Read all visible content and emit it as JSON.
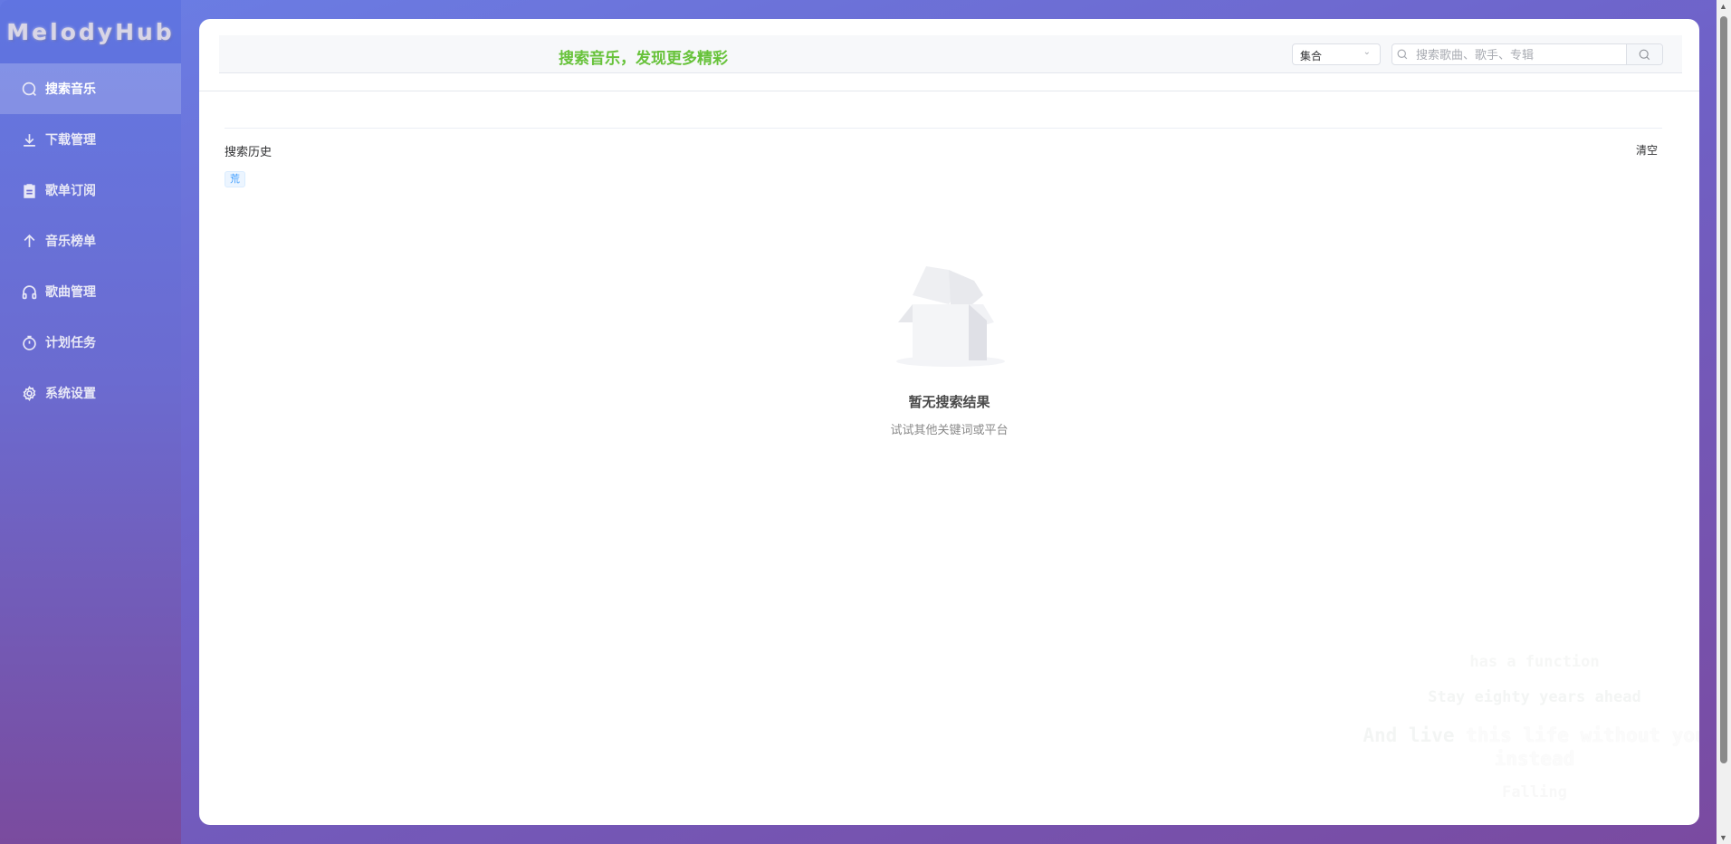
{
  "app": {
    "logo": "MelodyHub"
  },
  "sidebar": {
    "items": [
      {
        "label": "搜索音乐",
        "icon": "search-icon",
        "active": true
      },
      {
        "label": "下载管理",
        "icon": "download-icon"
      },
      {
        "label": "歌单订阅",
        "icon": "clipboard-icon"
      },
      {
        "label": "音乐榜单",
        "icon": "arrow-up-icon"
      },
      {
        "label": "歌曲管理",
        "icon": "headphones-icon"
      },
      {
        "label": "计划任务",
        "icon": "timer-icon"
      },
      {
        "label": "系统设置",
        "icon": "gear-icon"
      }
    ]
  },
  "header": {
    "title": "搜索音乐，发现更多精彩",
    "platform_select": "集合",
    "search_placeholder": "搜索歌曲、歌手、专辑",
    "search_value": ""
  },
  "history": {
    "title": "搜索历史",
    "clear_label": "清空",
    "tags": [
      "荒"
    ]
  },
  "empty": {
    "title": "暂无搜索结果",
    "subtitle": "试试其他关键词或平台"
  },
  "lyrics": {
    "line1": "has a function",
    "line2": "Stay eighty years ahead",
    "line3_sung": "And live",
    "line3_rest": " this life without you instead",
    "line4": "Falling"
  },
  "colors": {
    "accent": "#67c23a",
    "tag": "#409eff"
  }
}
